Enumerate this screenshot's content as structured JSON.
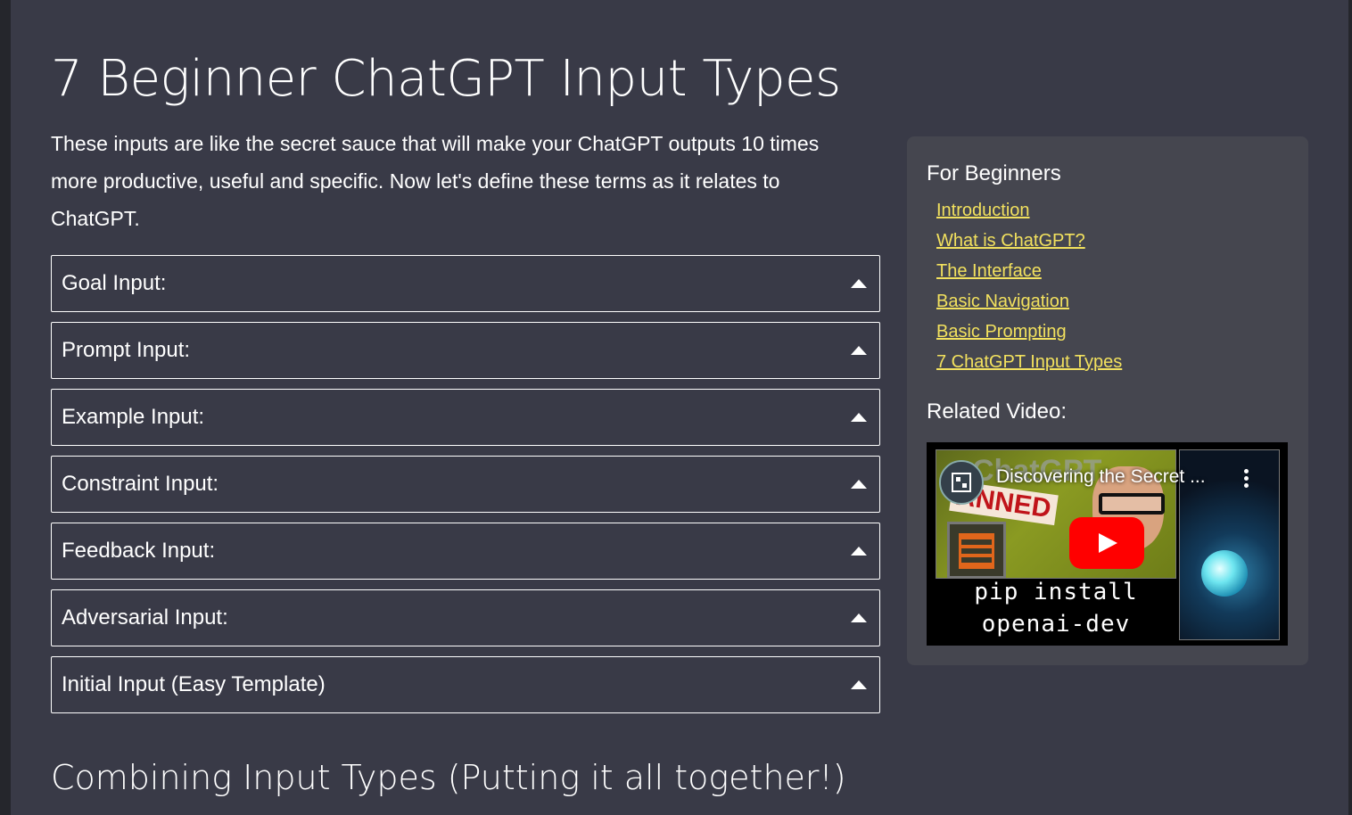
{
  "page": {
    "title": "7 Beginner ChatGPT Input Types",
    "intro": "These inputs are like the secret sauce that will make your ChatGPT outputs 10 times more productive, useful and specific. Now let's define these terms as it relates to ChatGPT.",
    "section_heading": "Combining Input Types (Putting it all together!)"
  },
  "accordion": {
    "items": [
      {
        "label": "Goal Input:"
      },
      {
        "label": "Prompt Input:"
      },
      {
        "label": "Example Input:"
      },
      {
        "label": "Constraint Input:"
      },
      {
        "label": "Feedback Input:"
      },
      {
        "label": "Adversarial Input:"
      },
      {
        "label": "Initial Input (Easy Template)"
      }
    ]
  },
  "sidebar": {
    "heading": "For Beginners",
    "links": [
      {
        "label": "Introduction"
      },
      {
        "label": "What is ChatGPT?"
      },
      {
        "label": "The Interface"
      },
      {
        "label": "Basic Navigation"
      },
      {
        "label": "Basic Prompting"
      },
      {
        "label": "7 ChatGPT Input Types"
      }
    ],
    "related_heading": "Related Video:",
    "video": {
      "title": "Discovering the Secret ...",
      "thumb_text_1": "ChatGPT",
      "thumb_text_2": "ANNED",
      "code_line_1": "pip install",
      "code_line_2": "openai-dev"
    }
  },
  "colors": {
    "page_bg": "#393a47",
    "outer_bg": "#25262c",
    "sidebar_bg": "#45464f",
    "link": "#f2e15e",
    "play_button": "#ff0000"
  },
  "icons": {
    "accordion_toggle": "caret-up-icon",
    "video_play": "play-icon",
    "video_menu": "more-vertical-icon",
    "channel": "channel-avatar-icon"
  }
}
